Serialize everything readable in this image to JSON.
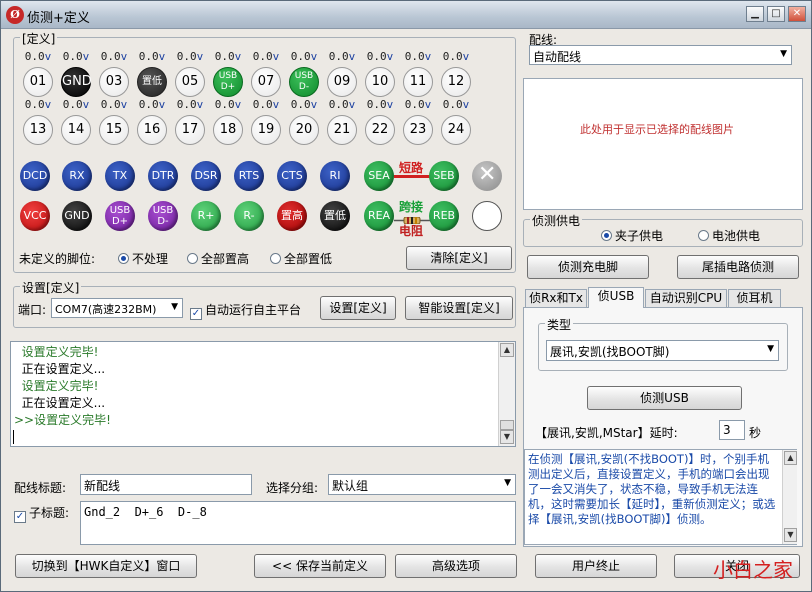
{
  "title": "侦测+定义",
  "app_icon": "Ø",
  "win_buttons": {
    "min": "▁",
    "max": "□",
    "close": "✕"
  },
  "define": {
    "group_label": "[定义]",
    "row1": [
      {
        "v": "0.0",
        "u": "v",
        "label": "01"
      },
      {
        "v": "0.0",
        "u": "v",
        "label": "GND"
      },
      {
        "v": "0.0",
        "u": "v",
        "label": "03"
      },
      {
        "v": "0.0",
        "u": "v",
        "label": "置低"
      },
      {
        "v": "0.0",
        "u": "v",
        "label": "05"
      },
      {
        "v": "0.0",
        "u": "v",
        "label": "USB D+"
      },
      {
        "v": "0.0",
        "u": "v",
        "label": "07"
      },
      {
        "v": "0.0",
        "u": "v",
        "label": "USB D-"
      },
      {
        "v": "0.0",
        "u": "v",
        "label": "09"
      },
      {
        "v": "0.0",
        "u": "v",
        "label": "10"
      },
      {
        "v": "0.0",
        "u": "v",
        "label": "11"
      },
      {
        "v": "0.0",
        "u": "v",
        "label": "12"
      }
    ],
    "row2": [
      {
        "v": "0.0",
        "u": "v",
        "label": "13"
      },
      {
        "v": "0.0",
        "u": "v",
        "label": "14"
      },
      {
        "v": "0.0",
        "u": "v",
        "label": "15"
      },
      {
        "v": "0.0",
        "u": "v",
        "label": "16"
      },
      {
        "v": "0.0",
        "u": "v",
        "label": "17"
      },
      {
        "v": "0.0",
        "u": "v",
        "label": "18"
      },
      {
        "v": "0.0",
        "u": "v",
        "label": "19"
      },
      {
        "v": "0.0",
        "u": "v",
        "label": "20"
      },
      {
        "v": "0.0",
        "u": "v",
        "label": "21"
      },
      {
        "v": "0.0",
        "u": "v",
        "label": "22"
      },
      {
        "v": "0.0",
        "u": "v",
        "label": "23"
      },
      {
        "v": "0.0",
        "u": "v",
        "label": "24"
      }
    ],
    "sig_row1": [
      "DCD",
      "RX",
      "TX",
      "DTR",
      "DSR",
      "RTS",
      "CTS",
      "RI"
    ],
    "sig_row2": [
      "VCC",
      "GND",
      "USB D+",
      "USB D-",
      "R+",
      "R-",
      "置高",
      "置低"
    ],
    "sea": "SEA",
    "seb": "SEB",
    "rea": "REA",
    "reb": "REB",
    "short": "短路",
    "bridge": "跨接",
    "resistor": "电阻",
    "undef_label": "未定义的脚位:",
    "undef_options": [
      "不处理",
      "全部置高",
      "全部置低"
    ],
    "clear_btn": "清除[定义]"
  },
  "settings": {
    "group_label": "设置[定义]",
    "port_label": "端口:",
    "port_value": "COM7(高速232BM)",
    "auto_run": "自动运行自主平台",
    "set_btn": "设置[定义]",
    "smart_btn": "智能设置[定义]"
  },
  "log": {
    "lines": [
      {
        "text": "  设置定义完毕!",
        "color": "#2a7a2a"
      },
      {
        "text": "  正在设置定义...",
        "color": "#000000"
      },
      {
        "text": "  设置定义完毕!",
        "color": "#2a7a2a"
      },
      {
        "text": "  正在设置定义...",
        "color": "#000000"
      },
      {
        "text": ">>设置定义完毕!",
        "color": "#2a7a2a"
      }
    ]
  },
  "wiring_title": {
    "label": "配线标题:",
    "value": "新配线"
  },
  "group_select": {
    "label": "选择分组:",
    "value": "默认组"
  },
  "subtitle": {
    "label": "子标题:",
    "value": "Gnd_2  D+_6  D-_8"
  },
  "bottom": {
    "switch_btn": "切换到【HWK自定义】窗口",
    "save_btn": "<<  保存当前定义",
    "adv_btn": "高级选项",
    "stop_btn": "用户终止",
    "close_btn": "关闭"
  },
  "right": {
    "wiring_label": "配线:",
    "wiring_value": "自动配线",
    "image_text": "此处用于显示已选择的配线图片",
    "power_label": "侦测供电",
    "power_options": [
      "夹子供电",
      "电池供电"
    ],
    "charge_btn": "侦测充电脚",
    "tail_btn": "尾插电路侦测",
    "tabs": [
      "侦Rx和Tx",
      "侦USB",
      "自动识别CPU",
      "侦耳机"
    ],
    "type_label": "类型",
    "type_value": "展讯,安凯(找BOOT脚)",
    "detect_usb_btn": "侦测USB",
    "delay_label": "【展讯,安凯,MStar】延时:",
    "delay_value": "3",
    "delay_unit": "秒",
    "info_text": "在侦测【展讯,安凯(不找BOOT)】时，个别手机测出定义后，直接设置定义，手机的端口会出现了一会又消失了，状态不稳，导致手机无法连机，这时需要加长【延时】，重新侦测定义；或选择【展讯,安凯(找BOOT脚)】侦测。"
  },
  "watermark": "小白之家",
  "colors": {
    "accent": "#1a4aa8",
    "log_green": "#2a7a2a",
    "image_text": "#c03030",
    "watermark": "#d42020"
  }
}
